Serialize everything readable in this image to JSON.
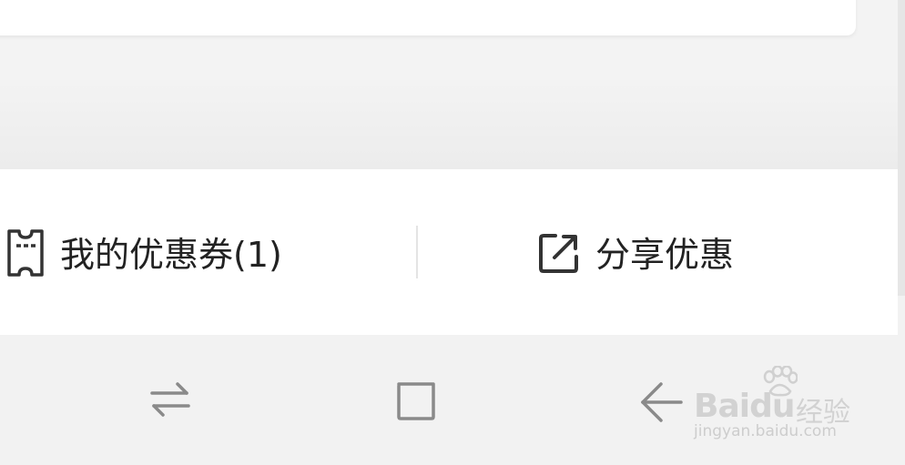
{
  "actions": {
    "coupons": {
      "label": "我的优惠券(1)",
      "icon": "ticket-icon"
    },
    "share": {
      "label": "分享优惠",
      "icon": "share-icon"
    }
  },
  "nav": {
    "switch_icon": "switch-arrows-icon",
    "home_icon": "square-home-icon",
    "back_icon": "back-arrow-icon"
  },
  "watermark": {
    "brand": "Baidu",
    "cn": "经验",
    "url": "jingyan.baidu.com"
  },
  "colors": {
    "text": "#222222",
    "icon": "#333333",
    "nav_icon": "#8a8a8a",
    "background": "#f2f2f2"
  }
}
